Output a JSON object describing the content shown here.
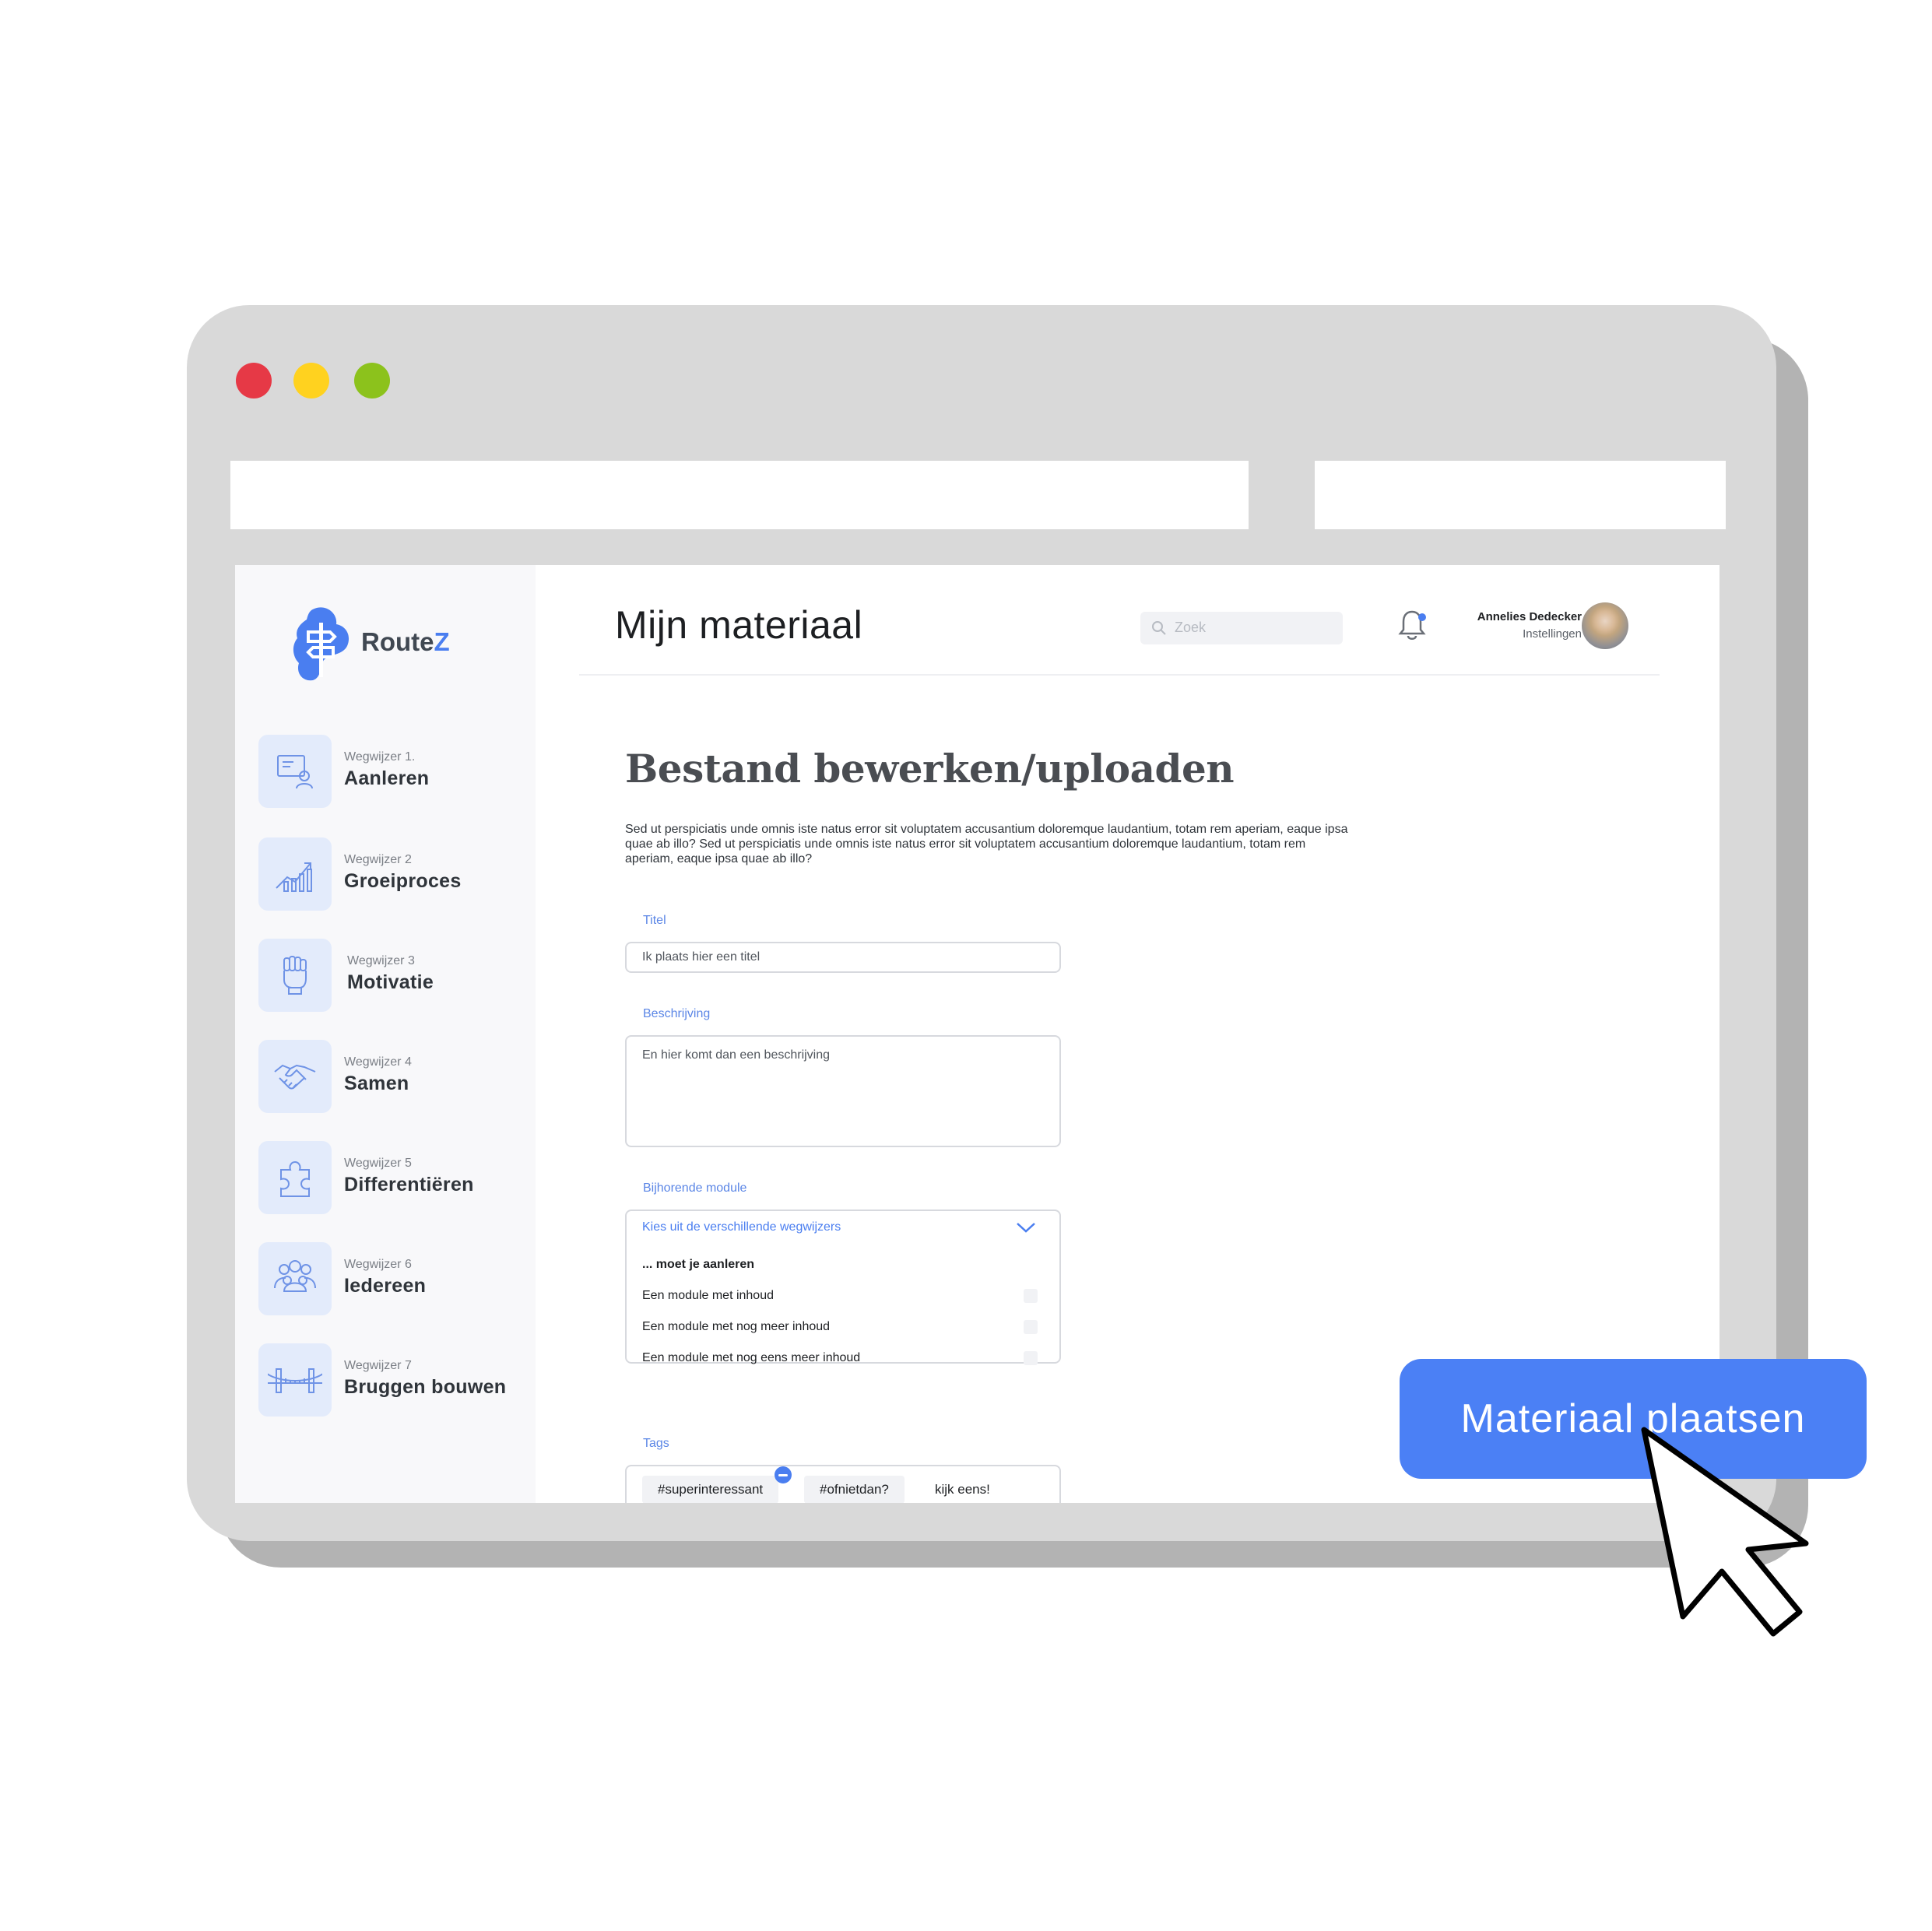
{
  "window": {
    "controls": [
      {
        "name": "close",
        "color": "#e63946"
      },
      {
        "name": "minimize",
        "color": "#ffd21f"
      },
      {
        "name": "maximize",
        "color": "#8cc21c"
      }
    ]
  },
  "brand": {
    "name_prefix": "Route",
    "name_suffix": "Z",
    "accent": "#4a7ef0"
  },
  "sidebar": {
    "items": [
      {
        "sub": "Wegwijzer 1.",
        "label": "Aanleren",
        "icon": "presentation-icon"
      },
      {
        "sub": "Wegwijzer 2",
        "label": "Groeiproces",
        "icon": "growth-chart-icon"
      },
      {
        "sub": "Wegwijzer 3",
        "label": "Motivatie",
        "icon": "fist-icon"
      },
      {
        "sub": "Wegwijzer 4",
        "label": "Samen",
        "icon": "handshake-icon"
      },
      {
        "sub": "Wegwijzer 5",
        "label": "Differentiëren",
        "icon": "puzzle-icon"
      },
      {
        "sub": "Wegwijzer 6",
        "label": "Iedereen",
        "icon": "group-icon"
      },
      {
        "sub": "Wegwijzer 7",
        "label": "Bruggen bouwen",
        "icon": "bridge-icon"
      }
    ]
  },
  "header": {
    "title": "Mijn materiaal",
    "search_placeholder": "Zoek",
    "user_name": "Annelies Dedecker",
    "user_settings": "Instellingen"
  },
  "form": {
    "title": "Bestand bewerken/uploaden",
    "intro": "Sed ut perspiciatis unde omnis iste natus error sit voluptatem accusantium doloremque laudantium, totam rem aperiam, eaque ipsa quae ab illo? Sed ut perspiciatis unde omnis iste natus error sit voluptatem accusantium doloremque laudantium, totam rem aperiam, eaque ipsa quae ab illo?",
    "title_label": "Titel",
    "title_placeholder": "Ik plaats hier een titel",
    "description_label": "Beschrijving",
    "description_placeholder": "En hier komt dan een beschrijving",
    "module_label": "Bijhorende module",
    "module_placeholder": "Kies uit de verschillende wegwijzers",
    "module_group": "... moet je aanleren",
    "module_options": [
      "Een module met inhoud",
      "Een module met nog meer inhoud",
      "Een module met nog eens meer inhoud"
    ],
    "tags_label": "Tags",
    "tags": [
      "#superinteressant",
      "#ofnietdan?"
    ],
    "tag_input": "kijk eens!"
  },
  "cta": {
    "label": "Materiaal plaatsen",
    "color": "#4b80f5"
  }
}
